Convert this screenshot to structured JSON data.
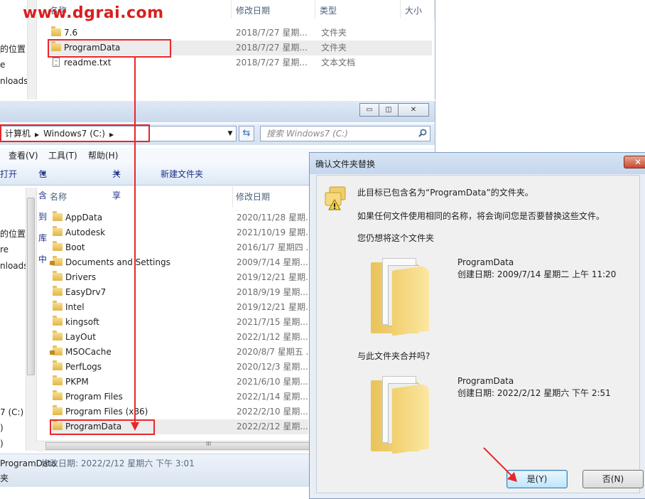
{
  "watermark": "www.dgrai.com",
  "top_window": {
    "nav_items": [
      "的位置",
      "e",
      "nloads"
    ],
    "columns": {
      "name": "名称",
      "date": "修改日期",
      "type": "类型",
      "size": "大小"
    },
    "files": [
      {
        "name": "7.6",
        "date": "2018/7/27 星期...",
        "type": "文件夹",
        "icon": "folder-icon"
      },
      {
        "name": "ProgramData",
        "date": "2018/7/27 星期...",
        "type": "文件夹",
        "icon": "folder-icon"
      },
      {
        "name": "readme.txt",
        "date": "2018/7/27 星期...",
        "type": "文本文档",
        "icon": "text-file-icon"
      }
    ]
  },
  "bottom_window": {
    "caption_buttons": {
      "minimize": "▭",
      "maximize": "◫",
      "close": "✕"
    },
    "address": {
      "computer": "计算机",
      "drive": "Windows7 (C:)"
    },
    "search_placeholder": "搜索 Windows7 (C:)",
    "menu": {
      "view": "查看(V)",
      "tools": "工具(T)",
      "help": "帮助(H)"
    },
    "commands": {
      "open": "打开",
      "include": "包含到库中",
      "share": "共享",
      "new_folder": "新建文件夹"
    },
    "nav_items": [
      "的位置",
      "re",
      "nloads",
      "7 (C:)",
      ")",
      ")"
    ],
    "columns": {
      "name": "名称",
      "date": "修改日期"
    },
    "files": [
      {
        "name": "AppData",
        "date": "2020/11/28 星期...",
        "locked": false
      },
      {
        "name": "Autodesk",
        "date": "2021/10/19 星期...",
        "locked": false
      },
      {
        "name": "Boot",
        "date": "2016/1/7 星期四 ...",
        "locked": false
      },
      {
        "name": "Documents and Settings",
        "date": "2009/7/14 星期...",
        "locked": true
      },
      {
        "name": "Drivers",
        "date": "2019/12/21 星期...",
        "locked": false
      },
      {
        "name": "EasyDrv7",
        "date": "2018/9/19 星期...",
        "locked": false
      },
      {
        "name": "Intel",
        "date": "2019/12/21 星期...",
        "locked": false
      },
      {
        "name": "kingsoft",
        "date": "2021/7/15 星期...",
        "locked": false
      },
      {
        "name": "LayOut",
        "date": "2022/1/12 星期...",
        "locked": false
      },
      {
        "name": "MSOCache",
        "date": "2020/8/7 星期五 ...",
        "locked": true
      },
      {
        "name": "PerfLogs",
        "date": "2020/12/3 星期...",
        "locked": false
      },
      {
        "name": "PKPM",
        "date": "2021/6/10 星期...",
        "locked": false
      },
      {
        "name": "Program Files",
        "date": "2022/1/14 星期...",
        "locked": false
      },
      {
        "name": "Program Files (x86)",
        "date": "2022/2/10 星期...",
        "locked": false
      },
      {
        "name": "ProgramData",
        "date": "2022/2/12 星期...",
        "locked": false
      }
    ],
    "hscroll_glyph": "III",
    "status": {
      "name": "ProgramData",
      "detail": "修改日期: 2022/2/12 星期六 下午 3:01",
      "type": "夹"
    }
  },
  "dialog": {
    "title": "确认文件夹替换",
    "close": "✕",
    "line1": "此目标已包含名为“ProgramData”的文件夹。",
    "line2": "如果任何文件使用相同的名称，将会询问您是否要替换这些文件。",
    "line3": "您仍想将这个文件夹",
    "target": {
      "name": "ProgramData",
      "created": "创建日期: 2009/7/14 星期二 上午 11:20"
    },
    "merge_question": "与此文件夹合并吗?",
    "source": {
      "name": "ProgramData",
      "created": "创建日期: 2022/2/12 星期六 下午 2:51"
    },
    "yes": "是(Y)",
    "no": "否(N)"
  },
  "colors": {
    "annotation_red": "#e8272b",
    "selection": "#ececec",
    "dialog_bg": "#f0f0f0"
  }
}
